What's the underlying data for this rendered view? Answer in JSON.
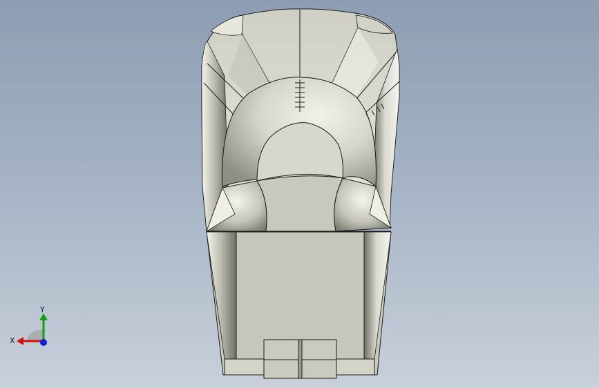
{
  "viewport": {
    "background_top": "#8d9db3",
    "background_bottom": "#c8d0da"
  },
  "model": {
    "body_color": "#c9c9bd",
    "shade_color": "#8d8d82",
    "edge_color": "#1a1a1a"
  },
  "triad": {
    "x_label": "X",
    "y_label": "Y",
    "x_color": "#d01010",
    "y_color": "#10a010",
    "z_color": "#1020d0"
  }
}
